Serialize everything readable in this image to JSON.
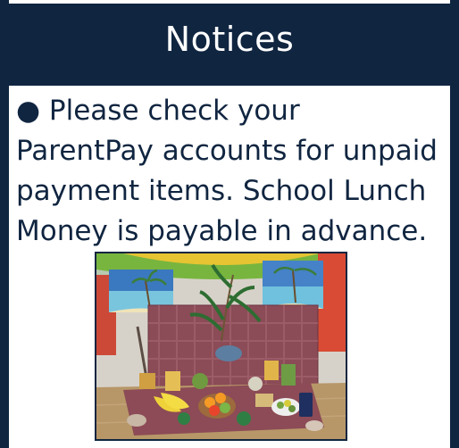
{
  "header": {
    "title": "Notices"
  },
  "notice": {
    "bullet": "●",
    "text": "Please check your ParentPay accounts for unpaid payment items. School Lunch Money is payable in advance."
  },
  "photo": {
    "subject": "fruit-display-image"
  },
  "colors": {
    "panel_background": "#102540",
    "content_background": "#ffffff",
    "text": "#102540",
    "title": "#ffffff"
  }
}
